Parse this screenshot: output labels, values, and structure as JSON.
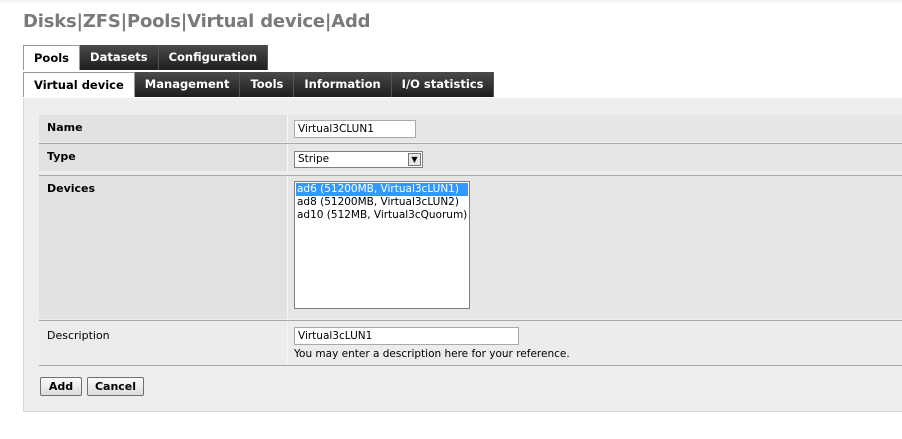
{
  "page": {
    "title": "Disks|ZFS|Pools|Virtual device|Add"
  },
  "tabs_primary": [
    {
      "label": "Pools",
      "active": true
    },
    {
      "label": "Datasets",
      "active": false
    },
    {
      "label": "Configuration",
      "active": false
    }
  ],
  "tabs_secondary": [
    {
      "label": "Virtual device",
      "active": true
    },
    {
      "label": "Management",
      "active": false
    },
    {
      "label": "Tools",
      "active": false
    },
    {
      "label": "Information",
      "active": false
    },
    {
      "label": "I/O statistics",
      "active": false
    }
  ],
  "form": {
    "name_label": "Name",
    "name_value": "Virtual3CLUN1",
    "type_label": "Type",
    "type_value": "Stripe",
    "devices_label": "Devices",
    "devices": [
      {
        "label": "ad6 (51200MB, Virtual3cLUN1)",
        "selected": true
      },
      {
        "label": "ad8 (51200MB, Virtual3cLUN2)",
        "selected": false
      },
      {
        "label": "ad10 (512MB, Virtual3cQuorum)",
        "selected": false
      }
    ],
    "description_label": "Description",
    "description_value": "Virtual3cLUN1",
    "description_hint": "You may enter a description here for your reference."
  },
  "buttons": {
    "add_label": "Add",
    "cancel_label": "Cancel"
  },
  "colors": {
    "selection": "#3399ff",
    "tab_dark": "#2b2b2b",
    "title_gray": "#7a7a7a"
  }
}
